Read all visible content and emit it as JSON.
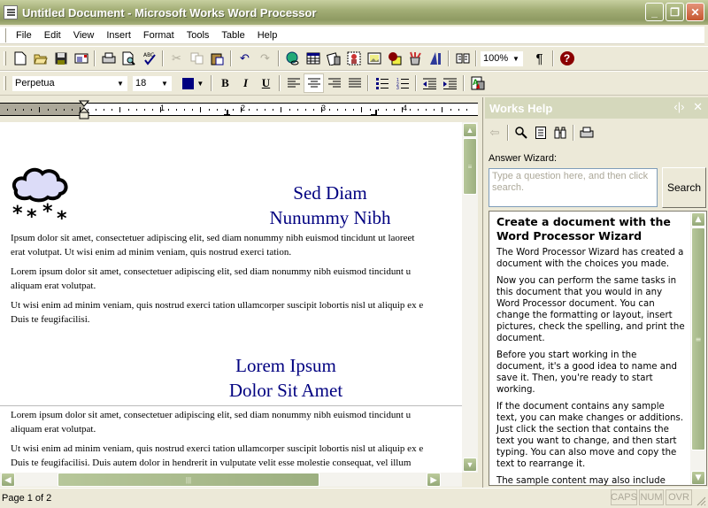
{
  "window": {
    "title": "Untitled Document - Microsoft Works Word Processor",
    "controls": [
      "minimize",
      "restore",
      "close"
    ]
  },
  "menu": [
    {
      "label": "File",
      "key": "F"
    },
    {
      "label": "Edit",
      "key": "E"
    },
    {
      "label": "View",
      "key": "V"
    },
    {
      "label": "Insert",
      "key": "I"
    },
    {
      "label": "Format",
      "key": "o"
    },
    {
      "label": "Tools",
      "key": "T"
    },
    {
      "label": "Table",
      "key": "a"
    },
    {
      "label": "Help",
      "key": "H"
    }
  ],
  "standard_toolbar": {
    "buttons": [
      "new-icon",
      "open-icon",
      "save-icon",
      "email-icon",
      "print-icon",
      "print-preview-icon",
      "spelling-icon",
      "cut-icon",
      "copy-icon",
      "paste-icon",
      "undo-icon",
      "redo-icon",
      "hyperlink-icon",
      "insert-table-icon",
      "insert-spreadsheet-icon",
      "clip-art-icon",
      "picture-icon",
      "drawing-icon",
      "paint-icon",
      "wordart-icon",
      "thesaurus-icon"
    ],
    "zoom": "100%",
    "pilcrow": "¶",
    "help": "?"
  },
  "format_toolbar": {
    "font": "Perpetua",
    "size": "18",
    "font_color": "#000080",
    "bold": "B",
    "italic": "I",
    "underline": "U",
    "alignment_active": "center"
  },
  "ruler": {
    "numbers": [
      "1",
      "2",
      "3",
      "4"
    ]
  },
  "document": {
    "heading1": [
      "Sed Diam",
      "Nunummy Nibh"
    ],
    "para1": [
      "Ipsum dolor sit amet, consectetuer adipiscing elit, sed diam nonummy nibh euismod tincidunt ut laoreet",
      "erat volutpat. Ut wisi enim ad minim veniam, quis nostrud exerci tation."
    ],
    "para2": [
      "Lorem ipsum dolor sit amet, consectetuer adipiscing elit, sed diam nonummy nibh euismod tincidunt u",
      "aliquam erat volutpat."
    ],
    "para3": [
      "Ut wisi enim ad minim veniam, quis nostrud exerci tation ullamcorper suscipit lobortis nisl ut aliquip ex e",
      "Duis te feugifacilisi."
    ],
    "heading2": [
      "Lorem Ipsum",
      "Dolor Sit Amet"
    ],
    "para4": [
      "Lorem ipsum dolor sit amet, consectetuer adipiscing elit, sed diam nonummy nibh euismod tincidunt u",
      "aliquam erat volutpat."
    ],
    "para5": [
      "Ut wisi enim ad minim veniam, quis nostrud exerci tation ullamcorper suscipit lobortis nisl ut aliquip ex e",
      "Duis te feugifacilisi. Duis autem dolor in hendrerit in vulputate velit esse molestie consequat, vel illum"
    ]
  },
  "help_pane": {
    "title": "Works Help",
    "answer_wizard_label": "Answer Wizard:",
    "input_placeholder": "Type a question here, and then click search.",
    "search_button": "Search",
    "content_title": "Create a document with the Word Processor Wizard",
    "paragraphs": [
      "The Word Processor Wizard has created a document with the choices you made.",
      "Now you can perform the same tasks in this document that you would in any Word Processor document. You can change the formatting or layout, insert pictures, check the spelling, and print the document.",
      "Before you start working in the document, it's a good idea to name and save it. Then, you're ready to start working.",
      "If the document contains any sample text, you can make changes or additions. Just click the section that contains the text you want to change, and then start typing. You can also move and copy the text to rearrange it.",
      "The sample content may also include writing tips. Be sure to delete the tips by"
    ]
  },
  "status": {
    "page": "Page 1 of 2",
    "caps": "CAPS",
    "num": "NUM",
    "ovr": "OVR"
  }
}
